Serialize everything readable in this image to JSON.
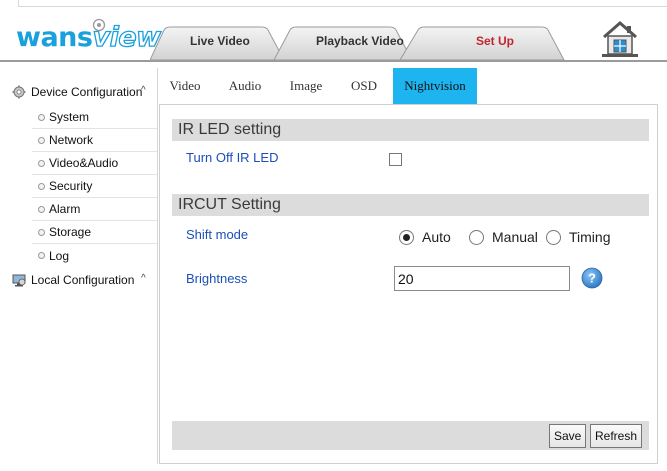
{
  "header": {
    "logo_left": "wans",
    "logo_right": "view",
    "nav_tabs": [
      {
        "label": "Live Video",
        "active": false
      },
      {
        "label": "Playback Video",
        "active": false
      },
      {
        "label": "Set Up",
        "active": true
      }
    ],
    "home_icon": "home-icon"
  },
  "sidebar": {
    "groups": [
      {
        "label": "Device Configuration",
        "icon": "gear-icon",
        "caret": "^"
      },
      {
        "label": "Local Configuration",
        "icon": "computer-icon",
        "caret": "^"
      }
    ],
    "items": [
      {
        "label": "System"
      },
      {
        "label": "Network"
      },
      {
        "label": "Video&Audio"
      },
      {
        "label": "Security"
      },
      {
        "label": "Alarm"
      },
      {
        "label": "Storage"
      },
      {
        "label": "Log"
      }
    ]
  },
  "subtabs": [
    {
      "label": "Video",
      "active": false
    },
    {
      "label": "Audio",
      "active": false
    },
    {
      "label": "Image",
      "active": false
    },
    {
      "label": "OSD",
      "active": false
    },
    {
      "label": "Nightvision",
      "active": true
    }
  ],
  "ir_led": {
    "title": "IR LED setting",
    "turn_off_label": "Turn Off IR LED",
    "turn_off_checked": false
  },
  "ircut": {
    "title": "IRCUT Setting",
    "shift_mode_label": "Shift mode",
    "options": [
      "Auto",
      "Manual",
      "Timing"
    ],
    "selected": "Auto",
    "brightness_label": "Brightness",
    "brightness_value": "20"
  },
  "buttons": {
    "save": "Save",
    "refresh": "Refresh"
  },
  "colors": {
    "brand_blue": "#1aa0dc",
    "active_tab_red": "#c0262e",
    "active_subtab": "#1eb4f0",
    "label_blue": "#1b4fb8"
  }
}
